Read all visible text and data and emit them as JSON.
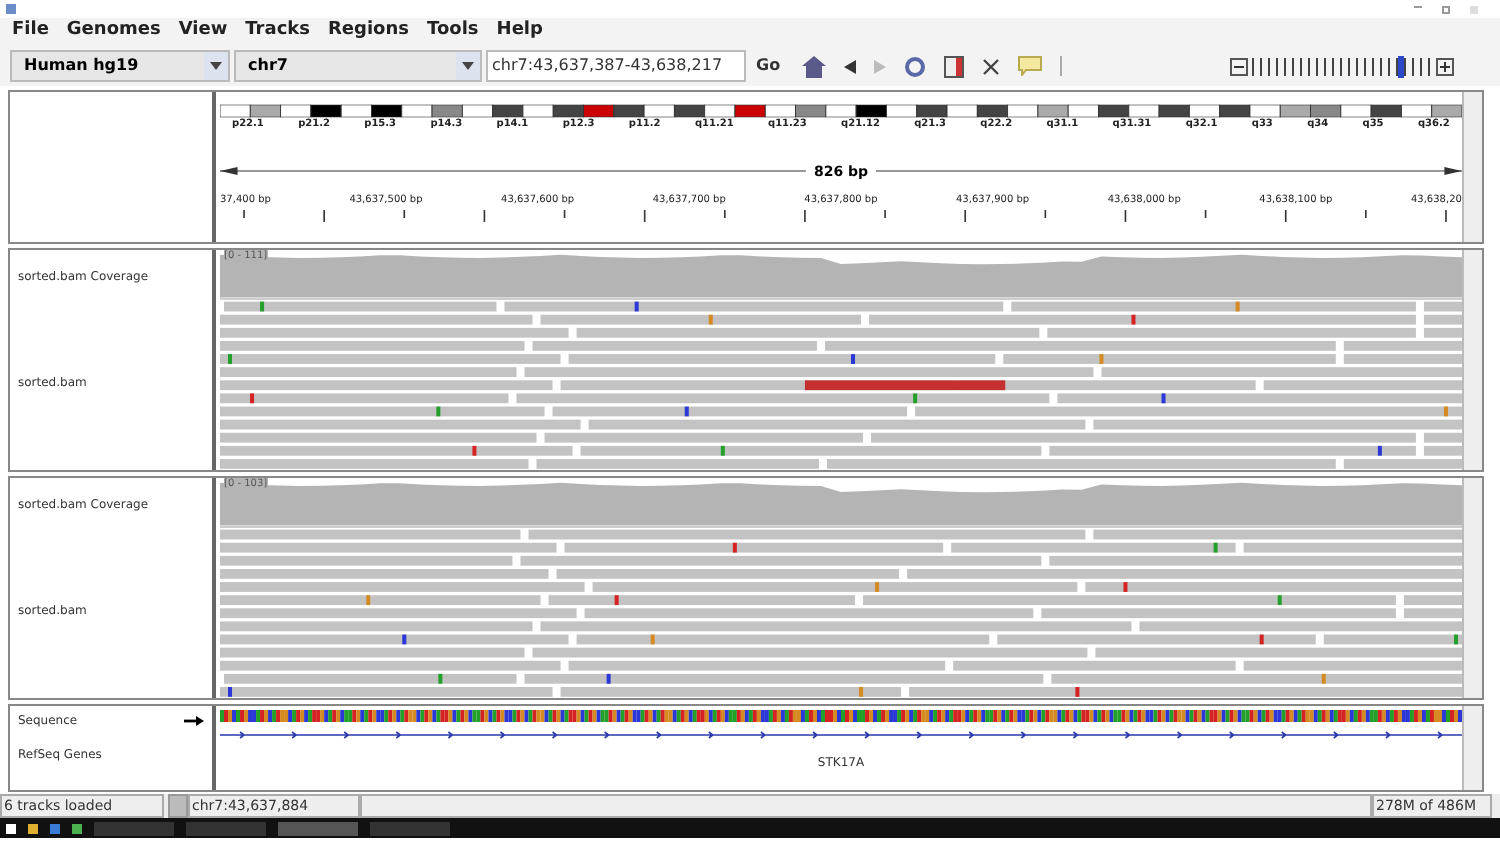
{
  "menu": [
    "File",
    "Genomes",
    "View",
    "Tracks",
    "Regions",
    "Tools",
    "Help"
  ],
  "toolbar": {
    "genome": "Human hg19",
    "chromosome": "chr7",
    "locus": "chr7:43,637,387-43,638,217",
    "go": "Go",
    "zoom": {
      "level": 0.84
    }
  },
  "ideogram": {
    "bands": [
      "p22.1",
      "p21.2",
      "p15.3",
      "p14.3",
      "p14.1",
      "p12.3",
      "p11.2",
      "q11.21",
      "q11.23",
      "q21.12",
      "q21.3",
      "q22.2",
      "q31.1",
      "q31.31",
      "q32.1",
      "q33",
      "q34",
      "q35",
      "q36.2"
    ]
  },
  "ruler": {
    "span": "826 bp",
    "ticks": [
      "37,400 bp",
      "43,637,500 bp",
      "43,637,600 bp",
      "43,637,700 bp",
      "43,637,800 bp",
      "43,637,900 bp",
      "43,638,000 bp",
      "43,638,100 bp",
      "43,638,20"
    ]
  },
  "panels": [
    {
      "coverage": {
        "name": "sorted.bam Coverage",
        "range": "[0 - 111]"
      },
      "alignments": {
        "name": "sorted.bam"
      }
    },
    {
      "coverage": {
        "name": "sorted.bam Coverage",
        "range": "[0 - 103]"
      },
      "alignments": {
        "name": "sorted.bam"
      }
    }
  ],
  "features": {
    "tracks": [
      {
        "name": "Sequence",
        "kind": "sequence"
      },
      {
        "name": "RefSeq Genes",
        "kind": "genes"
      }
    ],
    "gene": "STK17A"
  },
  "status": {
    "message": "6 tracks loaded",
    "position": "chr7:43,637,884",
    "memory": "278M of 486M"
  }
}
